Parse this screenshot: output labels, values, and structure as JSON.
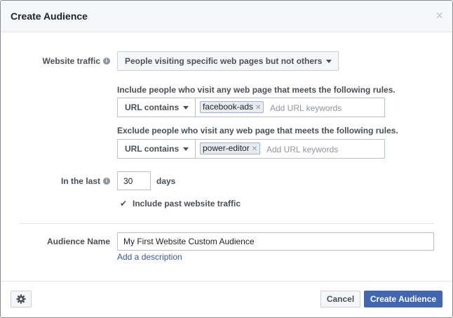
{
  "dialog": {
    "title": "Create Audience",
    "close_symbol": "×"
  },
  "website_traffic": {
    "label": "Website traffic",
    "info_symbol": "i",
    "selected": "People visiting specific web pages but not others"
  },
  "include_rule": {
    "heading": "Include people who visit any web page that meets the following rules.",
    "condition": "URL contains",
    "tokens": [
      "facebook-ads"
    ],
    "placeholder": "Add URL keywords"
  },
  "exclude_rule": {
    "heading": "Exclude people who visit any web page that meets the following rules.",
    "condition": "URL contains",
    "tokens": [
      "power-editor"
    ],
    "placeholder": "Add URL keywords"
  },
  "in_the_last": {
    "label": "In the last",
    "info_symbol": "i",
    "value": "30",
    "unit": "days"
  },
  "include_past": {
    "label": "Include past website traffic",
    "checked": true,
    "check_symbol": "✔"
  },
  "audience_name": {
    "label": "Audience Name",
    "value": "My First Website Custom Audience",
    "add_description_link": "Add a description"
  },
  "footer": {
    "cancel_label": "Cancel",
    "create_label": "Create Audience",
    "gear_icon": "gear-icon"
  },
  "colors": {
    "primary": "#4267b2",
    "link": "#365899",
    "token_border": "#9cb4d8"
  }
}
